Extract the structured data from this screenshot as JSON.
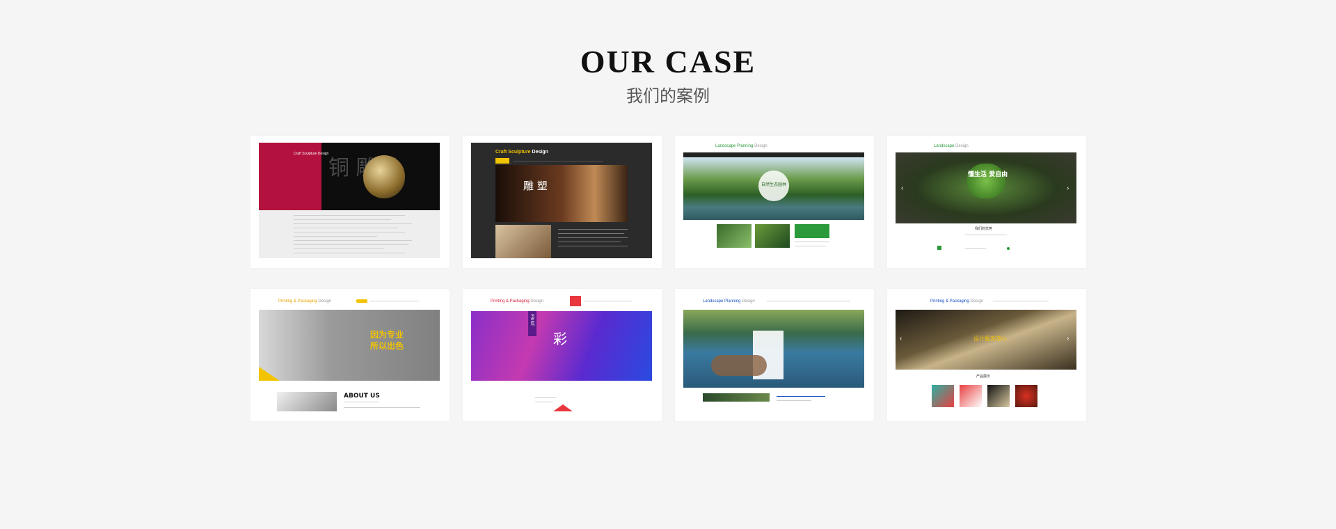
{
  "header": {
    "title": "OUR CASE",
    "subtitle": "我们的案例"
  },
  "cases": [
    {
      "brand": "Craft Sculpture Design",
      "hero": "铜 雕塑"
    },
    {
      "brand_a": "Craft Sculpture",
      "brand_b": "Design",
      "hero": "雕 塑"
    },
    {
      "brand_a": "Landscape Planning",
      "brand_b": "Design",
      "hero": "自然生态园林"
    },
    {
      "brand_a": "Landscape",
      "brand_b": "Design",
      "hero": "懂生活 爱自由",
      "section": "我们的优势"
    },
    {
      "brand_a": "Printing & Packaging",
      "brand_b": "Design",
      "hero_1": "因为专业",
      "hero_2": "所以出色",
      "about": "ABOUT US"
    },
    {
      "brand_a": "Printing & Packaging",
      "brand_b": "Design",
      "hero": "彩",
      "print": "PRINT"
    },
    {
      "brand_a": "Landscape Planning",
      "brand_b": "Design"
    },
    {
      "brand_a": "Printing & Packaging",
      "brand_b": "Design",
      "hero": "设计服务放心",
      "section": "产品展示"
    }
  ],
  "colors": {
    "bg": "#f5f5f5",
    "accent_red": "#b3123e",
    "accent_yellow": "#f2c300",
    "green": "#2a9a3a",
    "blue": "#1a4fc2"
  }
}
